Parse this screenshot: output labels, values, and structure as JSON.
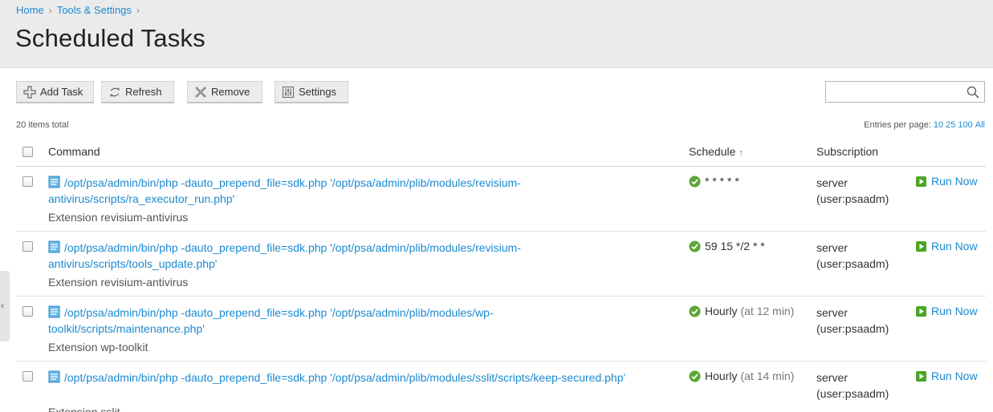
{
  "breadcrumb": {
    "home": "Home",
    "tools": "Tools & Settings"
  },
  "page_title": "Scheduled Tasks",
  "toolbar": {
    "add_task": "Add Task",
    "refresh": "Refresh",
    "remove": "Remove",
    "settings": "Settings"
  },
  "search": {
    "value": "",
    "placeholder": ""
  },
  "list_info": {
    "total": "20 items total",
    "entries_label": "Entries per page:",
    "opt_10": "10",
    "opt_25": "25",
    "opt_100": "100",
    "opt_all": "All"
  },
  "columns": {
    "command": "Command",
    "schedule": "Schedule",
    "schedule_sort": "↑",
    "subscription": "Subscription"
  },
  "rows": [
    {
      "command_l1": "/opt/psa/admin/bin/php -dauto_prepend_file=sdk.php '/opt/psa/admin/plib/modules/revisium-",
      "command_l2": "antivirus/scripts/ra_executor_run.php'",
      "description": "Extension revisium-antivirus",
      "schedule": "* * * * *",
      "schedule_extra": "",
      "sub_l1": "server",
      "sub_l2": "(user:psaadm)",
      "run": "Run Now"
    },
    {
      "command_l1": "/opt/psa/admin/bin/php -dauto_prepend_file=sdk.php '/opt/psa/admin/plib/modules/revisium-",
      "command_l2": "antivirus/scripts/tools_update.php'",
      "description": "Extension revisium-antivirus",
      "schedule": "59 15 */2 * *",
      "schedule_extra": "",
      "sub_l1": "server",
      "sub_l2": "(user:psaadm)",
      "run": "Run Now"
    },
    {
      "command_l1": "/opt/psa/admin/bin/php -dauto_prepend_file=sdk.php '/opt/psa/admin/plib/modules/wp-",
      "command_l2": "toolkit/scripts/maintenance.php'",
      "description": "Extension wp-toolkit",
      "schedule": "Hourly",
      "schedule_extra": "(at 12 min)",
      "sub_l1": "server",
      "sub_l2": "(user:psaadm)",
      "run": "Run Now"
    },
    {
      "command_l1": "/opt/psa/admin/bin/php -dauto_prepend_file=sdk.php '/opt/psa/admin/plib/modules/sslit/scripts/keep-secured.php'",
      "command_l2": "",
      "description": "Extension sslit",
      "schedule": "Hourly",
      "schedule_extra": "(at 14 min)",
      "sub_l1": "server",
      "sub_l2": "(user:psaadm)",
      "run": "Run Now"
    }
  ],
  "colors": {
    "link": "#1c8ad0",
    "ok_green": "#5ba634",
    "run_green": "#4aa524"
  },
  "side_tab": {
    "glyph": "‹"
  }
}
